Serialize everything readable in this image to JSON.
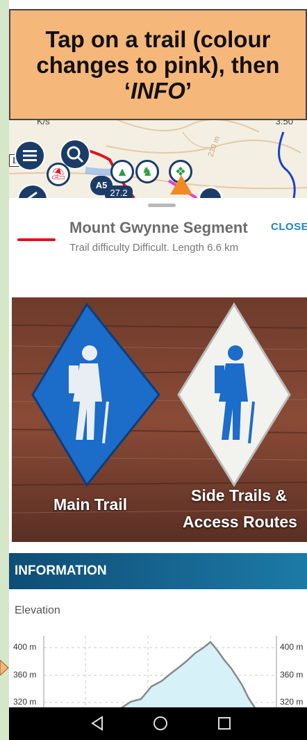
{
  "instruction": {
    "text": "Tap on a trail (colour changes to pink), then ‘",
    "emph": "INFO",
    "end": "’"
  },
  "statusbar": {
    "left": "K/s",
    "right": "3:50"
  },
  "map": {
    "label_lo": "Lo",
    "badge_a5": "A5",
    "badge_272": "27.2",
    "contour_label": "230 m"
  },
  "trail": {
    "name": "Mount Gwynne Segment",
    "meta": "Trail difficulty Difficult. Length 6.6 km",
    "line_color": "#e0131f"
  },
  "close_label": "CLOSE",
  "photo": {
    "caption_main": "Main Trail",
    "caption_side": "Side Trails &",
    "caption_side2": "Access Routes"
  },
  "info_label": "INFORMATION",
  "elevation": {
    "label": "Elevation",
    "ticks": [
      "400 m",
      "360 m",
      "320 m"
    ]
  },
  "colors": {
    "accent": "#1c83c8",
    "info_bar": "#0e4d76"
  }
}
